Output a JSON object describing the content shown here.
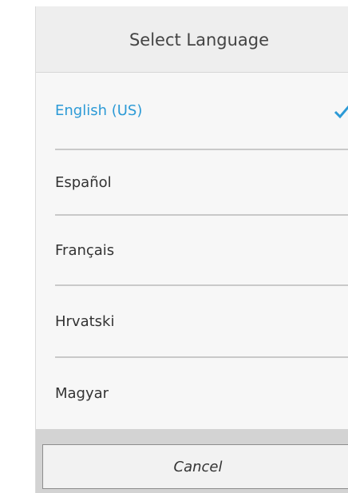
{
  "dialog": {
    "title": "Select Language",
    "languages": [
      {
        "label": "English (US)",
        "selected": true
      },
      {
        "label": "Español",
        "selected": false
      },
      {
        "label": "Français",
        "selected": false
      },
      {
        "label": "Hrvatski",
        "selected": false
      },
      {
        "label": "Magyar",
        "selected": false
      }
    ],
    "cancel_label": "Cancel"
  },
  "colors": {
    "accent": "#2c9ad6",
    "text": "#333333",
    "divider": "#c9c9c9",
    "footer": "#d3d3d3"
  },
  "icons": {
    "selected": "checkmark-icon"
  }
}
